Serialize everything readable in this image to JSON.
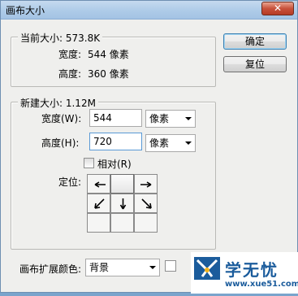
{
  "window": {
    "title": "画布大小",
    "close_glyph": "✕"
  },
  "current_size": {
    "group_label": "当前大小: 573.8K",
    "width_label": "宽度:",
    "width_value": "544 像素",
    "height_label": "高度:",
    "height_value": "360 像素"
  },
  "new_size": {
    "group_label": "新建大小: 1.12M",
    "width_label": "宽度(W):",
    "width_value": "544",
    "width_unit": "像素",
    "height_label": "高度(H):",
    "height_value": "720",
    "height_unit": "像素",
    "relative_label": "相对(R)",
    "relative_checked": false,
    "anchor_label": "定位:"
  },
  "buttons": {
    "ok": "确定",
    "reset": "复位"
  },
  "canvas_ext": {
    "label": "画布扩展颜色:",
    "value": "背景"
  },
  "watermark": {
    "text": "学无忧",
    "url": "www.xue51.com"
  },
  "colors": {
    "accent": "#1a5fa8",
    "logo_blue": "#1b5c9c",
    "titlebar": "#aecbe8"
  }
}
